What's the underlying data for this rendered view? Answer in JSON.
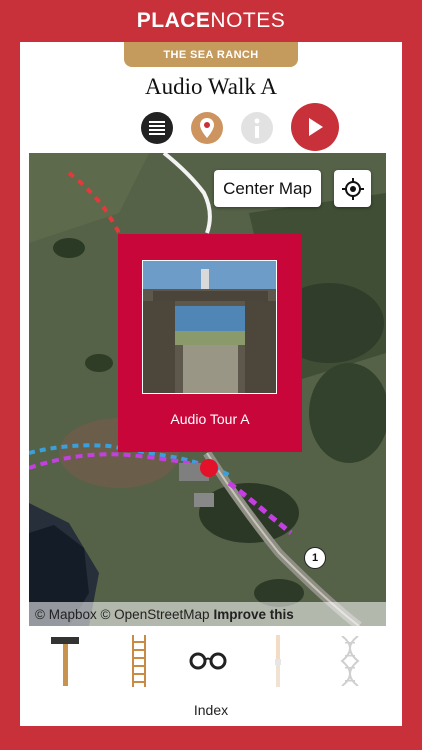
{
  "header": {
    "brand_bold": "PLACE",
    "brand_light": "NOTES"
  },
  "badge": {
    "label": "THE SEA RANCH"
  },
  "page": {
    "title": "Audio Walk A"
  },
  "toolbar_top": {
    "icons": [
      "list-icon",
      "map-pin-icon",
      "info-icon",
      "play-icon"
    ],
    "accent_color": "#c8313a",
    "pin_color": "#cd9460"
  },
  "map": {
    "center_button_label": "Center Map",
    "locate_icon": "crosshair-icon",
    "popup": {
      "caption": "Audio Tour A",
      "color": "#c8063a"
    },
    "marker_label": "1",
    "attribution": {
      "text": "© Mapbox © OpenStreetMap",
      "link": "Improve this"
    }
  },
  "bottom_tools": {
    "icons": [
      "hammer-icon",
      "ladder-icon",
      "glasses-icon",
      "brush-icon",
      "dna-icon"
    ],
    "selected_label": "Index"
  }
}
